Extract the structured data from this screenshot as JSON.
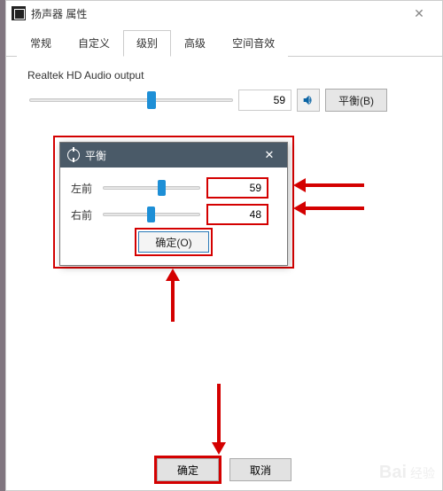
{
  "window": {
    "title": "扬声器 属性"
  },
  "tabs": {
    "items": [
      {
        "label": "常规"
      },
      {
        "label": "自定义"
      },
      {
        "label": "级别"
      },
      {
        "label": "高级"
      },
      {
        "label": "空间音效"
      }
    ],
    "active_index": 2
  },
  "level": {
    "device_name": "Realtek HD Audio output",
    "value": "59",
    "balance_button": "平衡(B)"
  },
  "balance_dialog": {
    "title": "平衡",
    "rows": [
      {
        "label": "左前",
        "value": "59",
        "pos": 59
      },
      {
        "label": "右前",
        "value": "48",
        "pos": 48
      }
    ],
    "ok": "确定(O)"
  },
  "footer": {
    "ok": "确定",
    "cancel": "取消"
  },
  "watermark": {
    "brand": "Bai",
    "suffix": "经验"
  }
}
